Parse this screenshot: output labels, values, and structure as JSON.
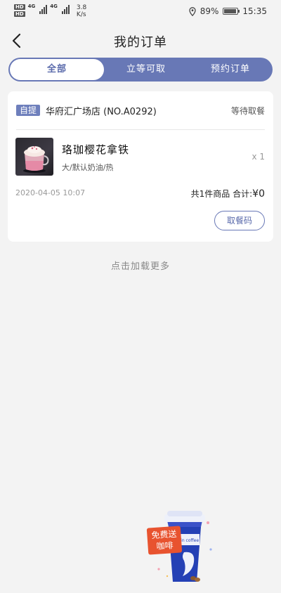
{
  "status_bar": {
    "hd1": "HD",
    "hd2": "HD",
    "net1": "4G",
    "net2": "4G",
    "speed_value": "3.8",
    "speed_unit": "K/s",
    "battery_pct": "89%",
    "time": "15:35"
  },
  "nav": {
    "title": "我的订单"
  },
  "tabs": [
    {
      "label": "全部",
      "active": true
    },
    {
      "label": "立等可取",
      "active": false
    },
    {
      "label": "预约订单",
      "active": false
    }
  ],
  "order": {
    "type_tag": "自提",
    "store": "华府汇广场店 (NO.A0292)",
    "status": "等待取餐",
    "product_name": "珞珈樱花拿铁",
    "product_options": "大/默认奶油/热",
    "quantity": "x 1",
    "datetime": "2020-04-05 10:07",
    "summary_count": "共1件商品",
    "total_label": "合计:",
    "total_price": "¥0",
    "pickup_button": "取餐码"
  },
  "load_more": "点击加载更多",
  "promo": {
    "line1": "免费送",
    "line2": "咖啡",
    "cup_text": "luckin coffee"
  },
  "colors": {
    "accent": "#6878b6",
    "background": "#f3f3f3",
    "promo_red": "#e8532f"
  }
}
